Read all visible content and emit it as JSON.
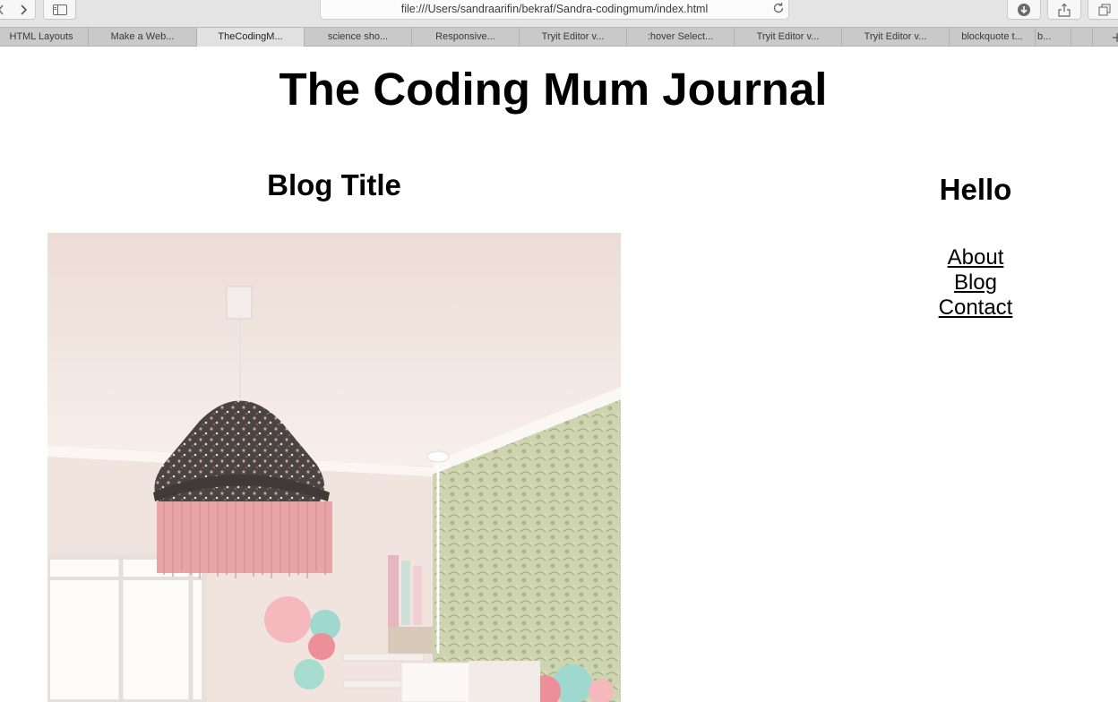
{
  "browser": {
    "url": "file:///Users/sandraarifin/bekraf/Sandra-codingmum/index.html",
    "tabs": [
      {
        "label": "HTML Layouts",
        "active": false
      },
      {
        "label": "Make a Web...",
        "active": false
      },
      {
        "label": "TheCodingM...",
        "active": true
      },
      {
        "label": "science sho...",
        "active": false
      },
      {
        "label": "Responsive...",
        "active": false
      },
      {
        "label": "Tryit Editor v...",
        "active": false
      },
      {
        "label": ":hover Select...",
        "active": false
      },
      {
        "label": "Tryit Editor v...",
        "active": false
      },
      {
        "label": "Tryit Editor v...",
        "active": false
      },
      {
        "label": "blockquote t...",
        "active": false
      },
      {
        "label": "b...",
        "active": false
      }
    ]
  },
  "page": {
    "site_title": "The Coding Mum Journal",
    "blog_title": "Blog Title",
    "aside_title": "Hello",
    "nav": [
      "About",
      "Blog",
      "Contact"
    ]
  }
}
